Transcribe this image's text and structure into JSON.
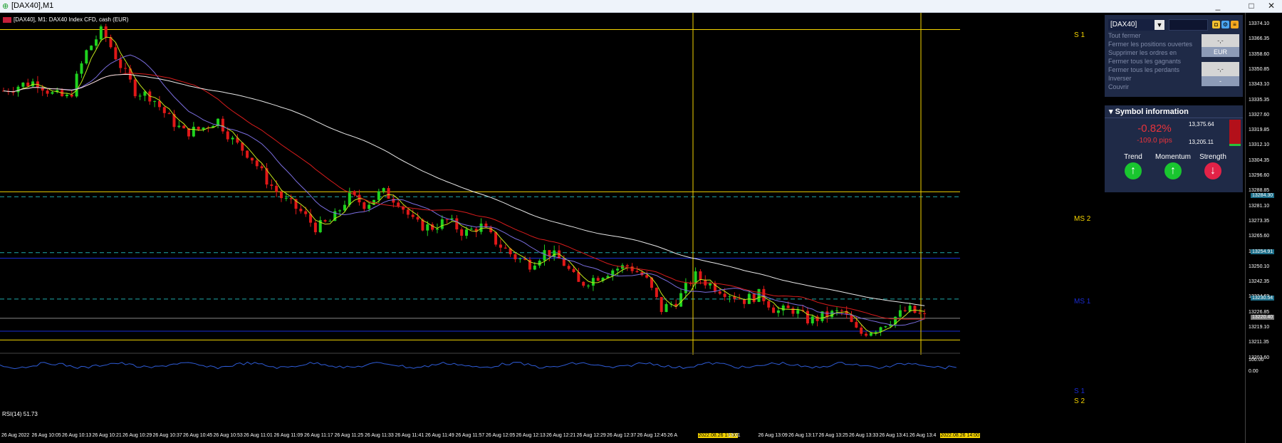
{
  "window": {
    "title": "[DAX40],M1",
    "minimize": "_",
    "maximize": "□",
    "close": "✕"
  },
  "chart": {
    "header": "[DAX40], M1:  DAX40 Index CFD, cash (EUR)",
    "levels": [
      {
        "label": "S 1",
        "price": 13372.2,
        "color": "#f5d400",
        "style": "solid"
      },
      {
        "label": "MS 2",
        "price": 13286.9,
        "color": "#f5d400",
        "style": "solid"
      },
      {
        "label": "MS 1",
        "price": 13252.0,
        "color": "#1a2bd1",
        "style": "solid"
      },
      {
        "label": "S 1",
        "price": 13213.6,
        "color": "#1a2bd1",
        "style": "solid"
      },
      {
        "label": "S 2",
        "price": 13209.0,
        "color": "#f5d400",
        "style": "solid"
      }
    ],
    "dashed_levels": [
      13284.3,
      13254.9,
      13230.5
    ],
    "price_tags": [
      {
        "text": "13284.30",
        "price": 13284.3,
        "color": "#1d6f8a"
      },
      {
        "text": "13254.91",
        "price": 13254.9,
        "color": "#1d6f8a"
      },
      {
        "text": "13230.54",
        "price": 13230.5,
        "color": "#1d6f8a"
      },
      {
        "text": "13220.40",
        "price": 13220.4,
        "color": "#7a7a7a"
      }
    ],
    "rsi_label": "RSI(14) 51.73",
    "colors": {
      "bull": "#1fd21f",
      "bear": "#e01818",
      "ma_fast": "#c3e61a",
      "ma_mid": "#7b6ee0",
      "ma_slow": "#d71c1c",
      "ma_long": "#e8e8e8",
      "vline": "#f5d400"
    }
  },
  "chart_data": {
    "type": "candlestick",
    "y_range": [
      13205,
      13378
    ],
    "close_points": [
      13340,
      13343,
      13345,
      13338,
      13336,
      13360,
      13372,
      13355,
      13340,
      13337,
      13326,
      13318,
      13320,
      13325,
      13313,
      13306,
      13293,
      13283,
      13277,
      13268,
      13272,
      13285,
      13280,
      13287,
      13282,
      13270,
      13268,
      13272,
      13265,
      13269,
      13260,
      13253,
      13249,
      13256,
      13250,
      13238,
      13242,
      13246,
      13248,
      13242,
      13225,
      13230,
      13243,
      13238,
      13234,
      13230,
      13233,
      13224,
      13225,
      13219,
      13222,
      13224,
      13212,
      13215,
      13220,
      13225,
      13221
    ],
    "y_ticks": [
      "13374.10",
      "13366.35",
      "13358.60",
      "13350.85",
      "13343.10",
      "13335.35",
      "13327.60",
      "13319.85",
      "13312.10",
      "13304.35",
      "13296.60",
      "13288.85",
      "13281.10",
      "13273.35",
      "13265.60",
      "13257.85",
      "13250.10",
      "13242.35",
      "13234.60",
      "13226.85",
      "13219.10",
      "13211.35",
      "13203.60",
      "100.00",
      "0.00"
    ],
    "x_ticks": [
      "26 Aug 2022",
      "26 Aug 10:05",
      "26 Aug 10:13",
      "26 Aug 10:21",
      "26 Aug 10:29",
      "26 Aug 10:37",
      "26 Aug 10:45",
      "26 Aug 10:53",
      "26 Aug 11:01",
      "26 Aug 11:09",
      "26 Aug 11:17",
      "26 Aug 11:25",
      "26 Aug 11:33",
      "26 Aug 11:41",
      "26 Aug 11:49",
      "26 Aug 11:57",
      "26 Aug 12:05",
      "26 Aug 12:13",
      "26 Aug 12:21",
      "26 Aug 12:29",
      "26 Aug 12:37",
      "26 Aug 12:45",
      "26 A",
      "2022.08.26 13:00",
      "13:01",
      "26 Aug 13:09",
      "26 Aug 13:17",
      "26 Aug 13:25",
      "26 Aug 13:33",
      "26 Aug 13:41",
      "26 Aug 13:4",
      "2022.08.26 14:00"
    ],
    "vlines": [
      "2022.08.26 13:00",
      "2022.08.26 14:00"
    ]
  },
  "trade_panel": {
    "symbol": "[DAX40]",
    "links": [
      "Tout fermer",
      "Fermer les positions ouvertes",
      "Supprimer les ordres en",
      "Fermer tous les gagnants",
      "Fermer tous les perdants",
      "Inverser",
      "Couvrir"
    ],
    "buttons": {
      "top": "-,-",
      "currency": "EUR",
      "bottom": "-,-",
      "small": "-"
    }
  },
  "symbol_info": {
    "title": "Symbol information",
    "percent": "-0.82%",
    "pips": "-109.0 pips",
    "high": "13,375.64",
    "low": "13,205.11",
    "indicators": [
      {
        "label": "Trend",
        "arrow": "↑",
        "dir": "up"
      },
      {
        "label": "Momentum",
        "arrow": "↑",
        "dir": "up"
      },
      {
        "label": "Strength",
        "arrow": "↓",
        "dir": "down"
      }
    ]
  }
}
